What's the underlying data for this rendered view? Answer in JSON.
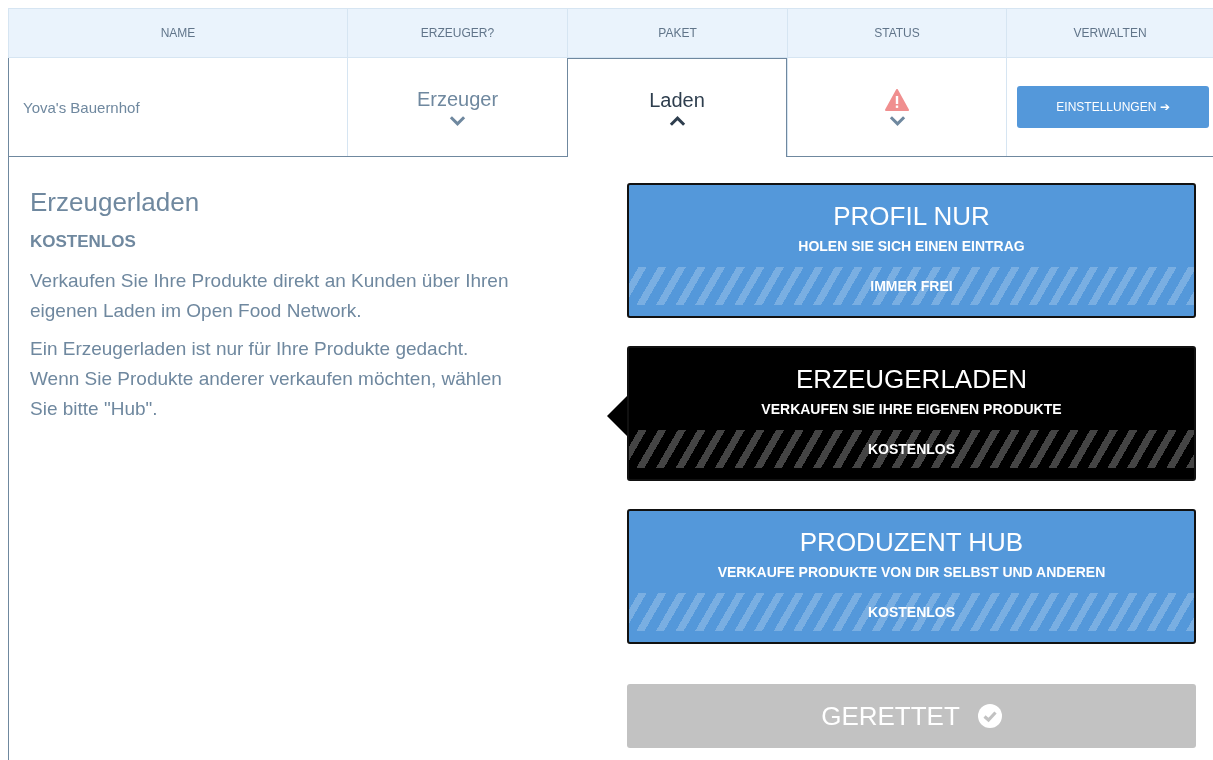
{
  "table": {
    "columns": [
      "NAME",
      "ERZEUGER?",
      "PAKET",
      "STATUS",
      "VERWALTEN"
    ],
    "row": {
      "name": "Yova's Bauernhof",
      "producer": {
        "label": "Erzeuger",
        "expanded": false
      },
      "package": {
        "label": "Laden",
        "expanded": true
      },
      "status": {
        "kind": "warning",
        "expanded": false
      },
      "manage_button": "EINSTELLUNGEN ➔"
    }
  },
  "detail": {
    "title": "Erzeugerladen",
    "price": "KOSTENLOS",
    "paragraphs": [
      "Verkaufen Sie Ihre Produkte direkt an Kunden über Ihren eigenen Laden im Open Food Network.",
      "Ein Erzeugerladen ist nur für Ihre Produkte gedacht. Wenn Sie Produkte anderer verkaufen möchten, wählen Sie bitte \"Hub\"."
    ],
    "plans": [
      {
        "title": "PROFIL NUR",
        "subtitle": "HOLEN SIE SICH EINEN EINTRAG",
        "price": "IMMER FREI",
        "selected": false
      },
      {
        "title": "ERZEUGERLADEN",
        "subtitle": "VERKAUFEN SIE IHRE EIGENEN PRODUKTE",
        "price": "KOSTENLOS",
        "selected": true
      },
      {
        "title": "PRODUZENT HUB",
        "subtitle": "VERKAUFE PRODUKTE VON DIR SELBST UND ANDEREN",
        "price": "KOSTENLOS",
        "selected": false
      }
    ],
    "save_button": {
      "label": "GERETTET",
      "disabled": true
    }
  }
}
